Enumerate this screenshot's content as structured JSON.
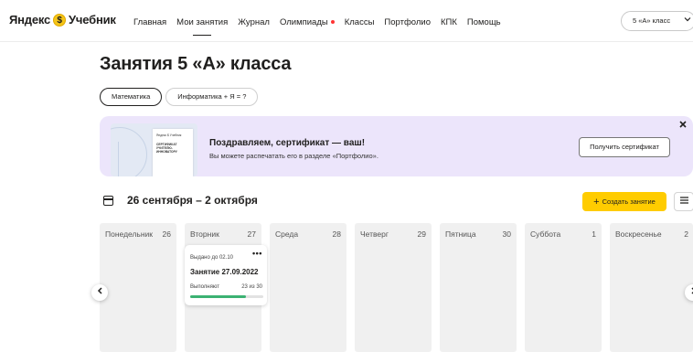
{
  "header": {
    "logo_brand": "Яндекс",
    "logo_icon": "$",
    "logo_product": "Учебник",
    "nav": [
      {
        "label": "Главная"
      },
      {
        "label": "Мои занятия"
      },
      {
        "label": "Журнал"
      },
      {
        "label": "Олимпиады"
      },
      {
        "label": "Классы"
      },
      {
        "label": "Портфолио"
      },
      {
        "label": "КПК"
      },
      {
        "label": "Помощь"
      }
    ],
    "active_nav": "Мои занятия",
    "class_select": "5 «А» класс",
    "class_select_icon": "chevron-down-icon"
  },
  "page": {
    "title": "Занятия 5 «А» класса",
    "subjects": [
      {
        "label": "Математика",
        "selected": true
      },
      {
        "label": "Информатика + Я = ?",
        "selected": false
      }
    ]
  },
  "banner": {
    "cert_line1": "Яндекс $ Учебник",
    "cert_line2": "СЕРТИФИКАТ УЧИТЕЛЮ-ИННОВАТОРУ",
    "title": "Поздравляем, сертификат — ваш!",
    "subtitle": "Вы можете распечатать его в разделе «Портфолио».",
    "button": "Получить сертификат",
    "close_icon": "close-icon"
  },
  "week": {
    "range": "26 сентября – 2 октября",
    "create_label": "Создать занятие",
    "create_icon": "plus-icon",
    "list_icon": "list-view-icon",
    "days": [
      {
        "name": "Понедельник",
        "num": "26"
      },
      {
        "name": "Вторник",
        "num": "27"
      },
      {
        "name": "Среда",
        "num": "28"
      },
      {
        "name": "Четверг",
        "num": "29"
      },
      {
        "name": "Пятница",
        "num": "30"
      },
      {
        "name": "Суббота",
        "num": "1"
      },
      {
        "name": "Воскресенье",
        "num": "2"
      }
    ]
  },
  "lesson": {
    "due": "Выдано до 02.10",
    "title": "Занятие 27.09.2022",
    "progress_label": "Выполняют",
    "progress_count": "23 из 30",
    "progress_fraction": 0.767
  },
  "colors": {
    "accent_yellow": "#ffcc00",
    "banner_bg": "#ece5fb",
    "progress_green": "#3bb272",
    "notify_dot": "#ff3333"
  }
}
